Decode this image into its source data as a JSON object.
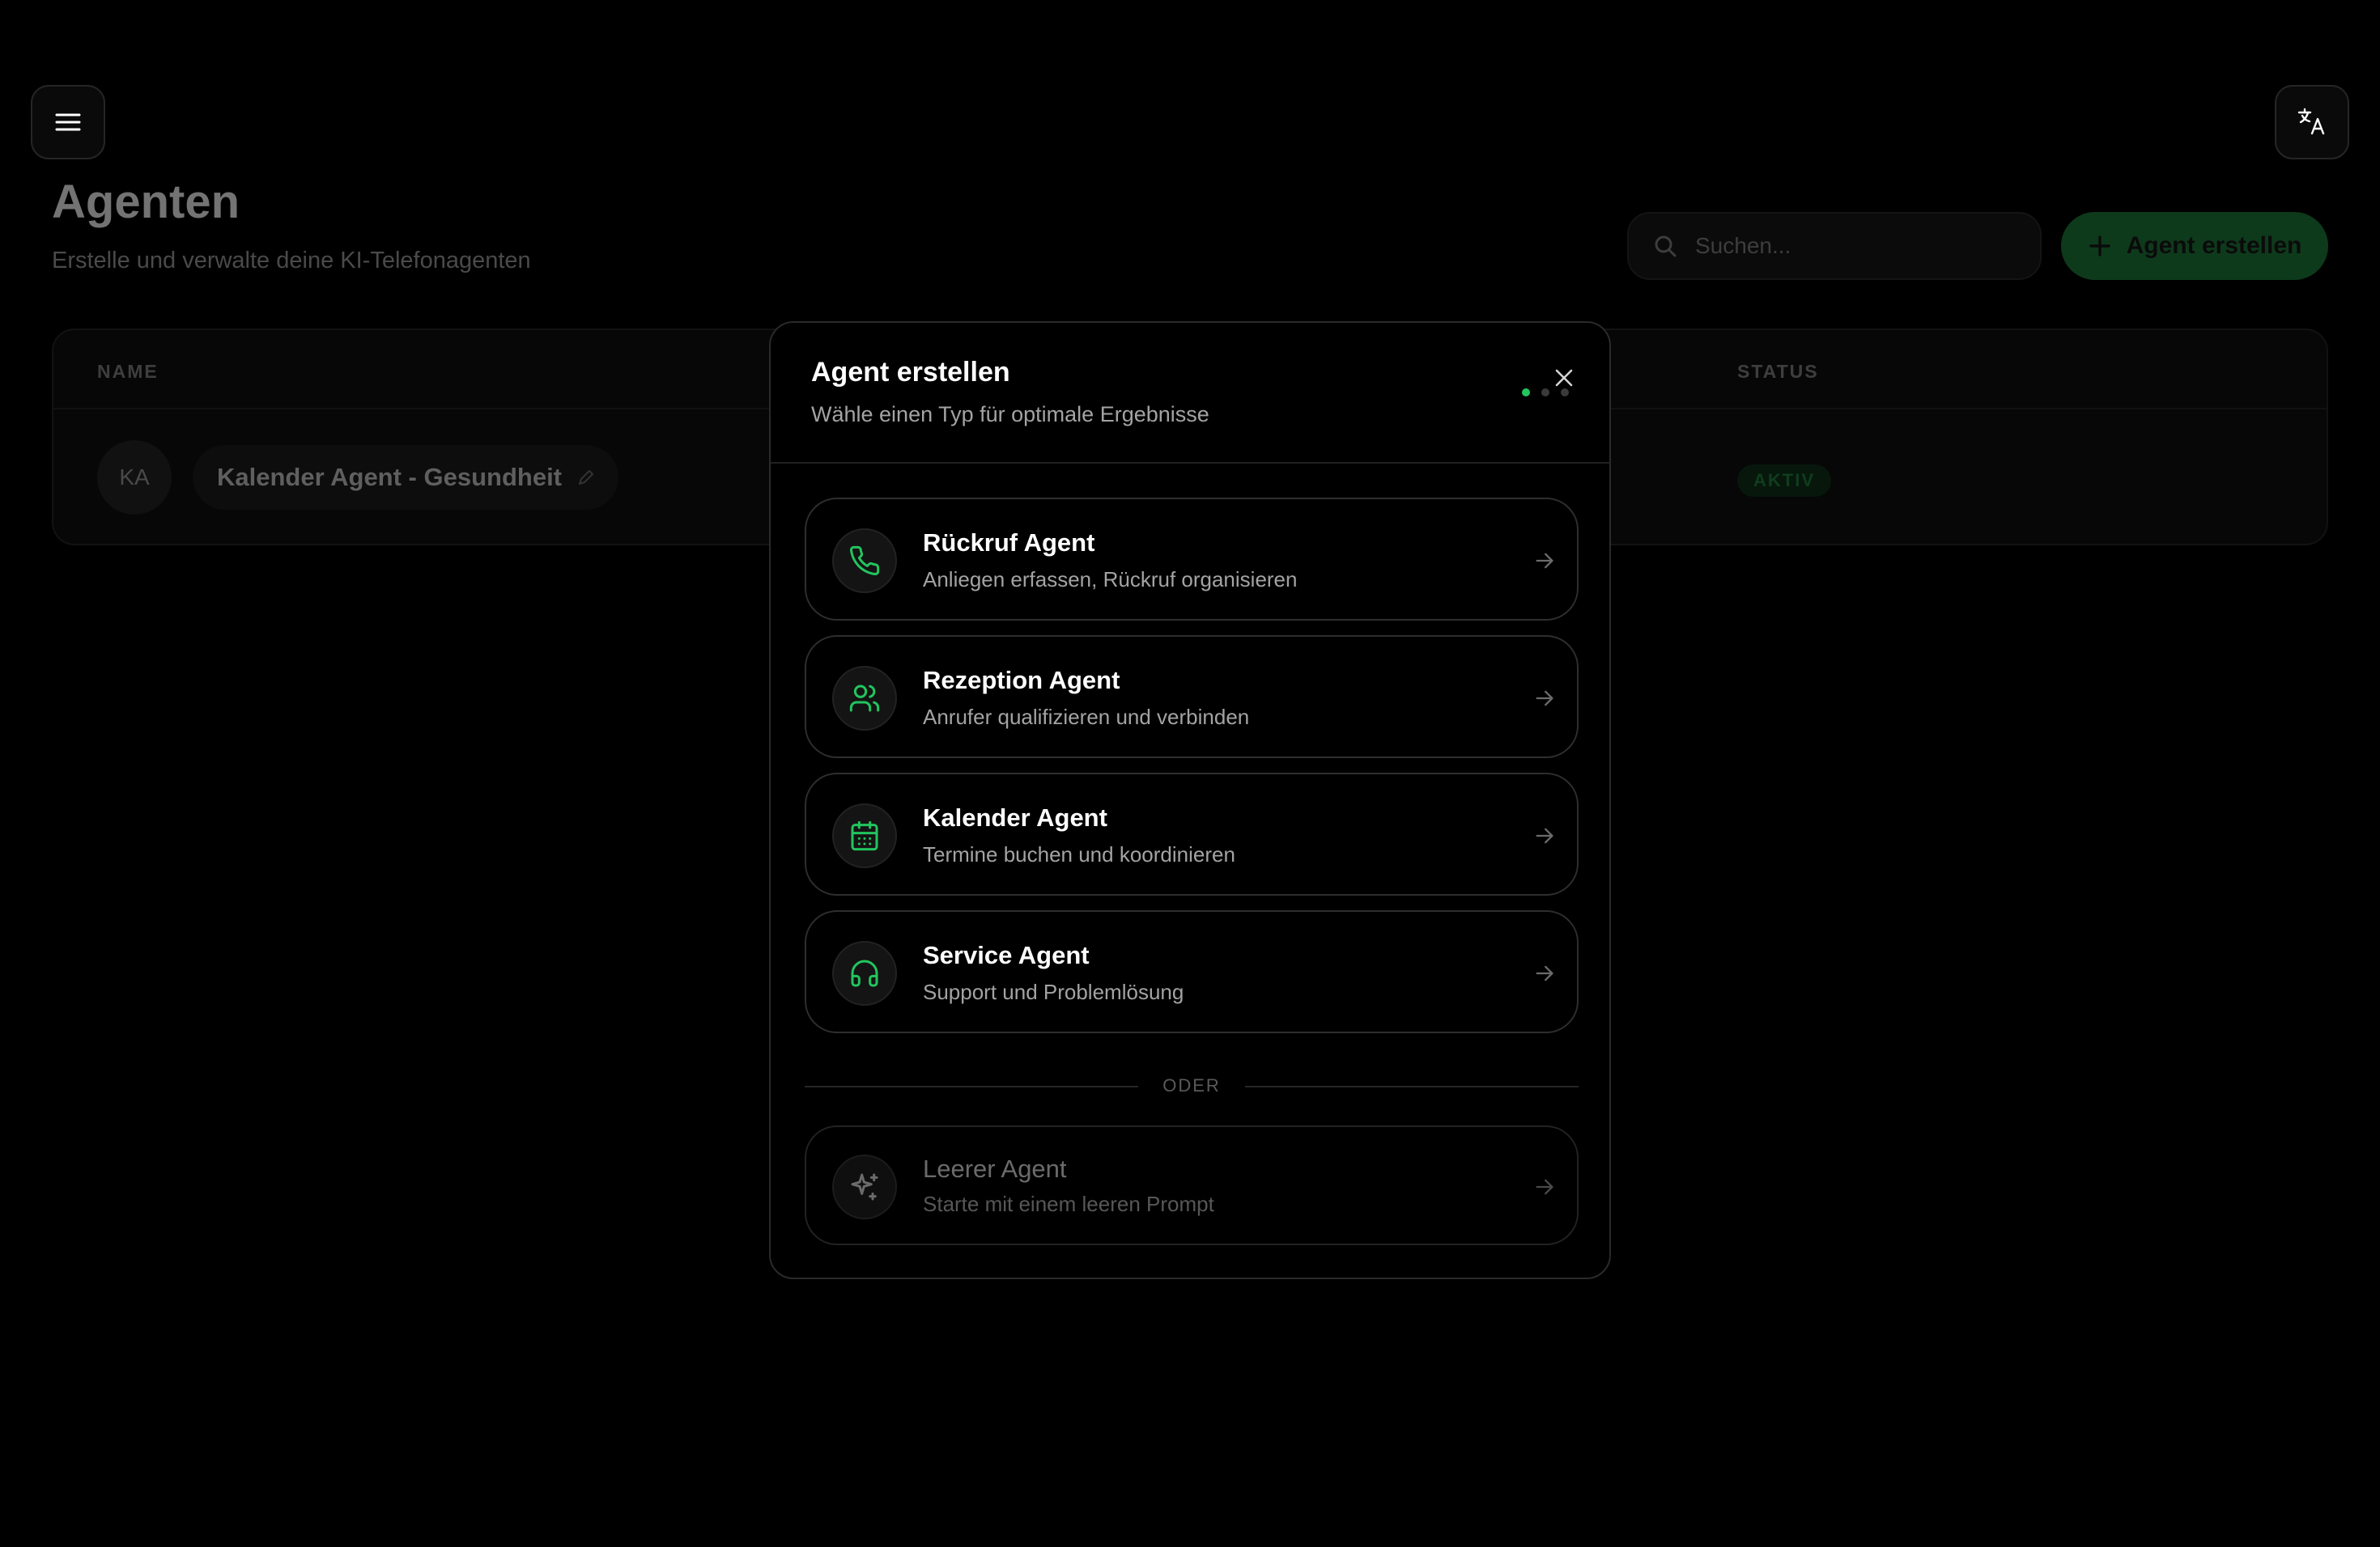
{
  "header": {
    "menu_icon": "menu-icon",
    "language_icon": "translate-icon"
  },
  "page": {
    "title": "Agenten",
    "subtitle": "Erstelle und verwalte deine KI-Telefonagenten",
    "search": {
      "placeholder": "Suchen..."
    },
    "create_button_label": "Agent erstellen"
  },
  "table": {
    "columns": [
      "NAME",
      "STATUS"
    ],
    "rows": [
      {
        "initials": "KA",
        "name": "Kalender Agent - Gesundheit",
        "status": "AKTIV"
      }
    ]
  },
  "modal": {
    "title": "Agent erstellen",
    "subtitle": "Wähle einen Typ für optimale Ergebnisse",
    "steps": {
      "total": 3,
      "current": 1
    },
    "options": [
      {
        "title": "Rückruf Agent",
        "description": "Anliegen erfassen, Rückruf organisieren",
        "icon": "phone-icon"
      },
      {
        "title": "Rezeption Agent",
        "description": "Anrufer qualifizieren und verbinden",
        "icon": "users-icon"
      },
      {
        "title": "Kalender Agent",
        "description": "Termine buchen und koordinieren",
        "icon": "calendar-icon"
      },
      {
        "title": "Service Agent",
        "description": "Support und Problemlösung",
        "icon": "headphones-icon"
      }
    ],
    "separator_label": "ODER",
    "blank_option": {
      "title": "Leerer Agent",
      "description": "Starte mit einem leeren Prompt",
      "icon": "sparkles-icon"
    }
  },
  "colors": {
    "accent": "#22c55e",
    "background": "#000000",
    "status_active": "#0f3d1e"
  }
}
